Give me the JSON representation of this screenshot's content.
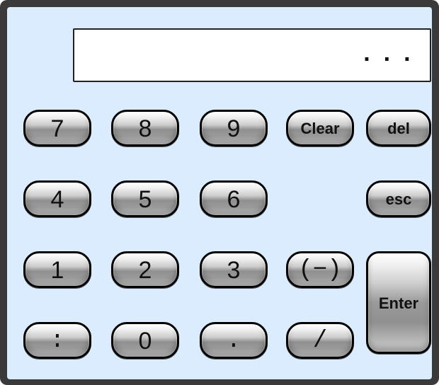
{
  "display": {
    "value": "..."
  },
  "keys": {
    "k7": "7",
    "k8": "8",
    "k9": "9",
    "clear": "Clear",
    "del": "del",
    "k4": "4",
    "k5": "5",
    "k6": "6",
    "esc": "esc",
    "k1": "1",
    "k2": "2",
    "k3": "3",
    "negate": "(−)",
    "enter": "Enter",
    "colon": ":",
    "k0": "0",
    "dot": ".",
    "slash": "/"
  }
}
